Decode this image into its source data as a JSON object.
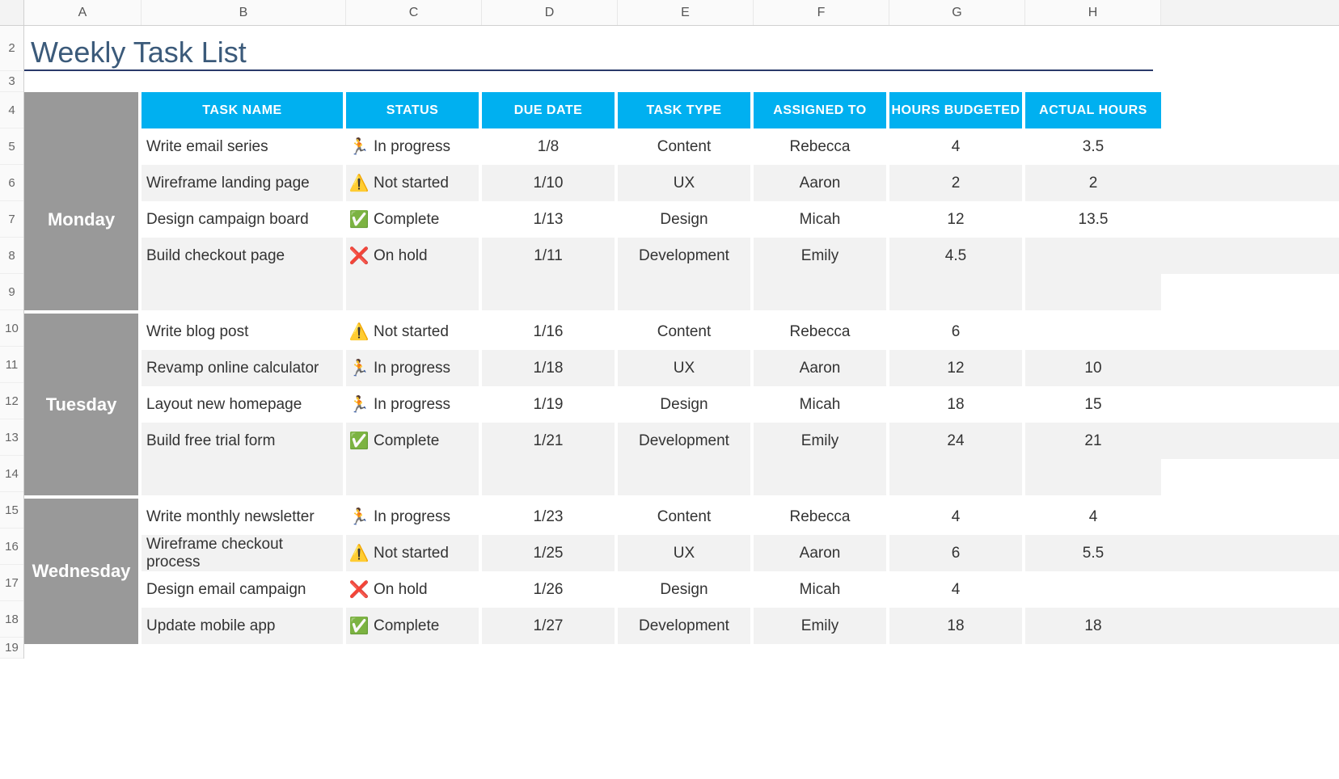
{
  "title": "Weekly Task List",
  "columns": [
    "A",
    "B",
    "C",
    "D",
    "E",
    "F",
    "G",
    "H"
  ],
  "headers": {
    "task_name": "TASK NAME",
    "status": "STATUS",
    "due_date": "DUE DATE",
    "task_type": "TASK TYPE",
    "assigned_to": "ASSIGNED TO",
    "hours_budgeted": "HOURS BUDGETED",
    "actual_hours": "ACTUAL HOURS"
  },
  "status_labels": {
    "in_progress": "In progress",
    "not_started": "Not started",
    "complete": "Complete",
    "on_hold": "On hold"
  },
  "status_icons": {
    "in_progress": "🏃",
    "not_started": "⚠️",
    "complete": "✅",
    "on_hold": "❌"
  },
  "days": [
    {
      "name": "Monday",
      "rows": [
        {
          "task": "Write email series",
          "status": "in_progress",
          "due": "1/8",
          "type": "Content",
          "assigned": "Rebecca",
          "budget": "4",
          "actual": "3.5"
        },
        {
          "task": "Wireframe landing page",
          "status": "not_started",
          "due": "1/10",
          "type": "UX",
          "assigned": "Aaron",
          "budget": "2",
          "actual": "2"
        },
        {
          "task": "Design campaign board",
          "status": "complete",
          "due": "1/13",
          "type": "Design",
          "assigned": "Micah",
          "budget": "12",
          "actual": "13.5"
        },
        {
          "task": "Build checkout page",
          "status": "on_hold",
          "due": "1/11",
          "type": "Development",
          "assigned": "Emily",
          "budget": "4.5",
          "actual": ""
        }
      ]
    },
    {
      "name": "Tuesday",
      "rows": [
        {
          "task": "Write blog post",
          "status": "not_started",
          "due": "1/16",
          "type": "Content",
          "assigned": "Rebecca",
          "budget": "6",
          "actual": ""
        },
        {
          "task": "Revamp online calculator",
          "status": "in_progress",
          "due": "1/18",
          "type": "UX",
          "assigned": "Aaron",
          "budget": "12",
          "actual": "10"
        },
        {
          "task": "Layout new homepage",
          "status": "in_progress",
          "due": "1/19",
          "type": "Design",
          "assigned": "Micah",
          "budget": "18",
          "actual": "15"
        },
        {
          "task": "Build free trial form",
          "status": "complete",
          "due": "1/21",
          "type": "Development",
          "assigned": "Emily",
          "budget": "24",
          "actual": "21"
        }
      ]
    },
    {
      "name": "Wednesday",
      "rows": [
        {
          "task": "Write monthly newsletter",
          "status": "in_progress",
          "due": "1/23",
          "type": "Content",
          "assigned": "Rebecca",
          "budget": "4",
          "actual": "4"
        },
        {
          "task": "Wireframe checkout process",
          "status": "not_started",
          "due": "1/25",
          "type": "UX",
          "assigned": "Aaron",
          "budget": "6",
          "actual": "5.5"
        },
        {
          "task": "Design email campaign",
          "status": "on_hold",
          "due": "1/26",
          "type": "Design",
          "assigned": "Micah",
          "budget": "4",
          "actual": ""
        },
        {
          "task": "Update mobile app",
          "status": "complete",
          "due": "1/27",
          "type": "Development",
          "assigned": "Emily",
          "budget": "18",
          "actual": "18"
        }
      ]
    }
  ],
  "row_numbers": [
    "2",
    "3",
    "4",
    "5",
    "6",
    "7",
    "8",
    "9",
    "10",
    "11",
    "12",
    "13",
    "14",
    "15",
    "16",
    "17",
    "18",
    "19"
  ]
}
